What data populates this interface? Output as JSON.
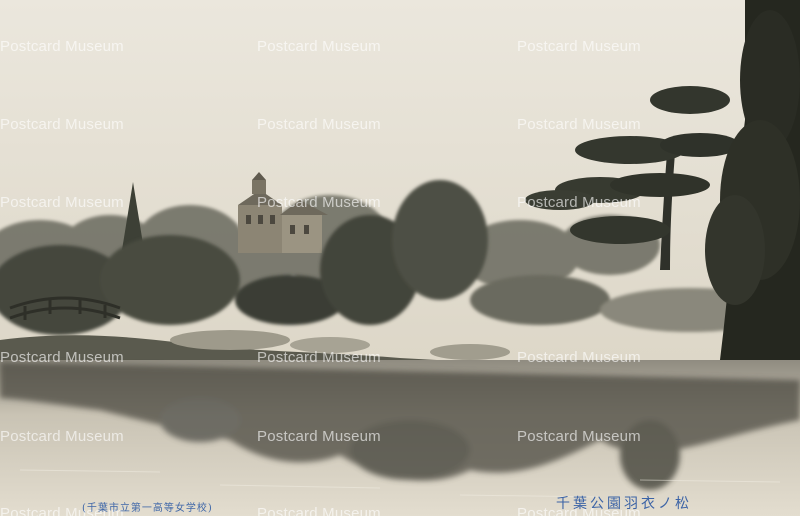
{
  "photo": {
    "subject": "Japanese garden with pond, arched bridge, pine trees and Western-style building",
    "tone": "sepia"
  },
  "captions": {
    "title_right": "千葉公園羽衣ノ松",
    "publisher_left": "(千葉市立第一高等女学校)"
  },
  "watermark": {
    "text": "Postcard Museum"
  },
  "colors": {
    "sky": "#e7e2d6",
    "foliage_dark": "#3a3c33",
    "water": "#cfc9bb",
    "caption_blue": "#3b63a6"
  }
}
